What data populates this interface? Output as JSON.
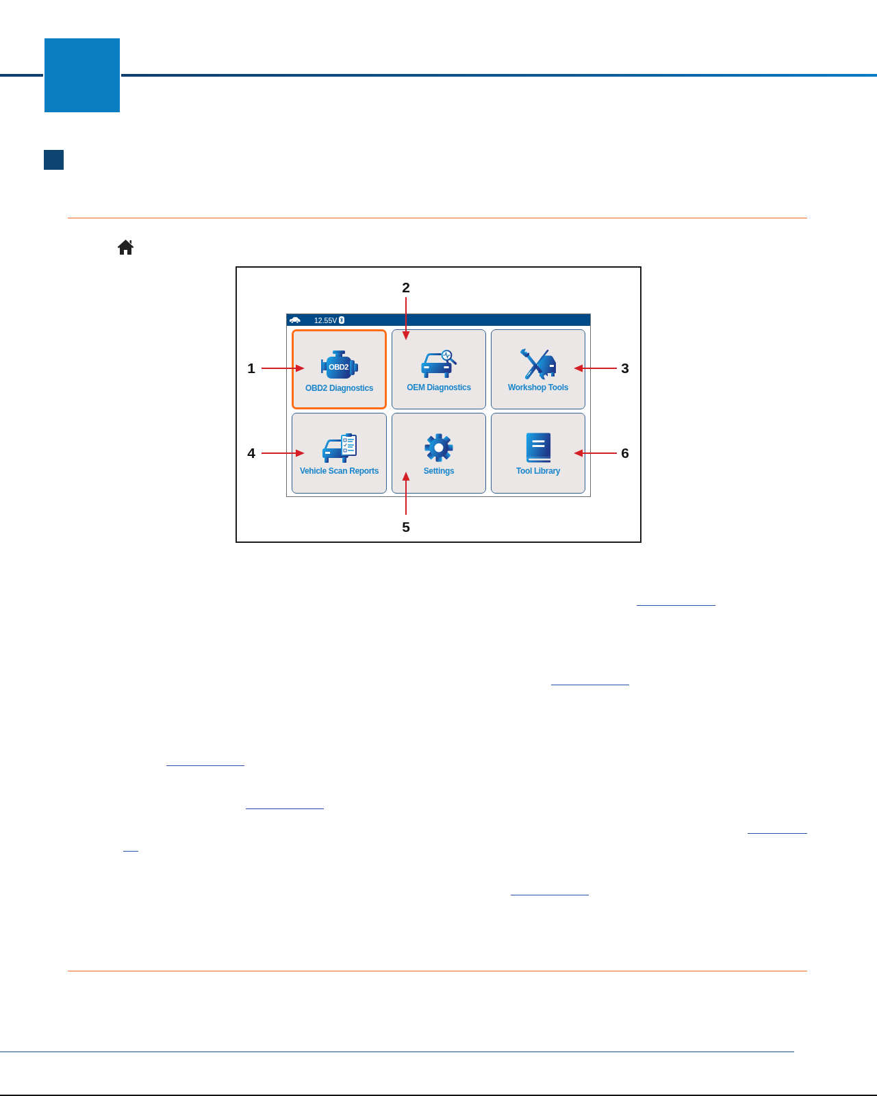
{
  "figure": {
    "screen": {
      "status_bar": {
        "voltage": "12.55V"
      },
      "tiles": [
        {
          "kind": "obd2",
          "label": "OBD2 Diagnostics",
          "badge": "OBD2",
          "selected": true
        },
        {
          "kind": "oem",
          "label": "OEM Diagnostics",
          "selected": false
        },
        {
          "kind": "workshop",
          "label": "Workshop Tools",
          "selected": false
        },
        {
          "kind": "reports",
          "label": "Vehicle Scan Reports",
          "selected": false
        },
        {
          "kind": "settings",
          "label": "Settings",
          "selected": false
        },
        {
          "kind": "library",
          "label": "Tool Library",
          "selected": false
        }
      ]
    },
    "callouts": [
      {
        "number": "1",
        "kind": "left"
      },
      {
        "number": "2",
        "kind": "top"
      },
      {
        "number": "3",
        "kind": "right"
      },
      {
        "number": "4",
        "kind": "left"
      },
      {
        "number": "5",
        "kind": "bottom"
      },
      {
        "number": "6",
        "kind": "right"
      }
    ]
  }
}
